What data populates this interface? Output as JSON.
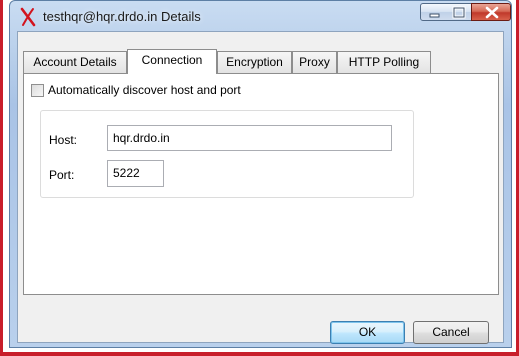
{
  "window": {
    "title": "testhqr@hqr.drdo.in Details",
    "icon": "red-x-icon",
    "controls": [
      "minimize-icon",
      "maximize-icon",
      "close-icon"
    ]
  },
  "tabs": [
    {
      "label": "Account Details",
      "active": false
    },
    {
      "label": "Connection",
      "active": true
    },
    {
      "label": "Encryption",
      "active": false
    },
    {
      "label": "Proxy",
      "active": false
    },
    {
      "label": "HTTP Polling",
      "active": false
    }
  ],
  "connection": {
    "auto_discover_label": "Automatically discover host and port",
    "auto_discover_checked": false,
    "host_label": "Host:",
    "host_value": "hqr.drdo.in",
    "port_label": "Port:",
    "port_value": "5222"
  },
  "buttons": {
    "ok": "OK",
    "cancel": "Cancel"
  },
  "colors": {
    "frame_red": "#c81e2b",
    "title_gradient": "#b6cde9",
    "ok_accent": "#3c7fb1"
  }
}
